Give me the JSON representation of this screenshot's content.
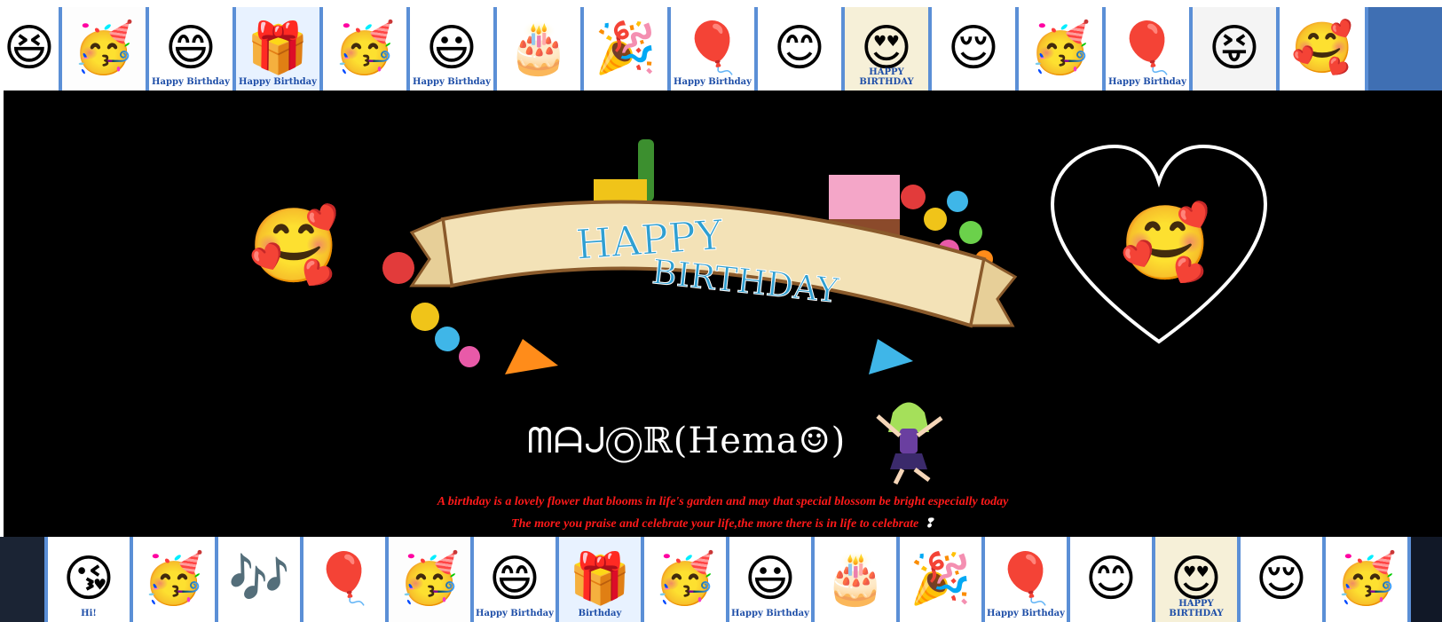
{
  "top_strip": {
    "tiles": [
      {
        "icon": "emoji-laugh-icon",
        "glyph": "😆",
        "bg": "#ffffff",
        "width": 70,
        "caption": ""
      },
      {
        "icon": "emoji-party-hat-icon",
        "glyph": "🥳",
        "bg": "#fdfdfd",
        "width": 98,
        "caption": ""
      },
      {
        "icon": "emoji-happy-birthday-icon",
        "glyph": "😄",
        "bg": "#ffffff",
        "width": 98,
        "caption": "Happy Birthday"
      },
      {
        "icon": "emoji-gift-icon",
        "glyph": "🎁",
        "bg": "#e8f2ff",
        "width": 98,
        "caption": "Happy Birthday"
      },
      {
        "icon": "emoji-blower-icon",
        "glyph": "🥳",
        "bg": "#ffffff",
        "width": 98,
        "caption": ""
      },
      {
        "icon": "emoji-thumbs-up-icon",
        "glyph": "😃",
        "bg": "#ffffff",
        "width": 98,
        "caption": "Happy Birthday"
      },
      {
        "icon": "emoji-cake-icon",
        "glyph": "🎂",
        "bg": "#ffffff",
        "width": 98,
        "caption": ""
      },
      {
        "icon": "emoji-confetti-icon",
        "glyph": "🎉",
        "bg": "#ffffff",
        "width": 98,
        "caption": ""
      },
      {
        "icon": "emoji-balloons-icon",
        "glyph": "🎈",
        "bg": "#ffffff",
        "width": 98,
        "caption": "Happy Birthday"
      },
      {
        "icon": "emoji-present-icon",
        "glyph": "😊",
        "bg": "#ffffff",
        "width": 98,
        "caption": ""
      },
      {
        "icon": "emoji-group-icon",
        "glyph": "😍",
        "bg": "#f6f0d8",
        "width": 98,
        "caption": "HAPPY BIRTHDAY"
      },
      {
        "icon": "emoji-spring-icon",
        "glyph": "😌",
        "bg": "#ffffff",
        "width": 98,
        "caption": ""
      },
      {
        "icon": "emoji-party-hat-big-icon",
        "glyph": "🥳",
        "bg": "#ffffff",
        "width": 98,
        "caption": ""
      },
      {
        "icon": "emoji-balloons-2-icon",
        "glyph": "🎈",
        "bg": "#ffffff",
        "width": 98,
        "caption": "Happy Birthday"
      },
      {
        "icon": "emoji-dance-icon",
        "glyph": "😝",
        "bg": "#f4f4f4",
        "width": 98,
        "caption": ""
      },
      {
        "icon": "emoji-love-cake-icon",
        "glyph": "🥰",
        "bg": "#ffffff",
        "width": 100,
        "caption": ""
      }
    ]
  },
  "banner": {
    "line1": "HAPPY",
    "line2": "BIRTHDAY"
  },
  "emoji_left": {
    "icon": "smiling-hearts-icon",
    "glyph": "🥰"
  },
  "emoji_heart": {
    "icon": "smiling-hearts-icon",
    "glyph": "🥰"
  },
  "name": "ᗰᗩᒍⓄℝ(Hema☺︎)",
  "quote_line1": "A birthday is a lovely flower that blooms in life's garden and may that special blossom be bright especially today",
  "quote_line2": "The more you praise and celebrate your life,the more there is in life to celebrate",
  "quote_line2_end": "❢",
  "bottom_strip": {
    "tiles": [
      {
        "icon": "dark-block-icon",
        "glyph": "",
        "bg": "#1b2434",
        "width": 54,
        "caption": ""
      },
      {
        "icon": "emoji-hi-icon",
        "glyph": "😘",
        "bg": "#ffffff",
        "width": 96,
        "caption": "Hi!"
      },
      {
        "icon": "emoji-party-hat-icon",
        "glyph": "🥳",
        "bg": "#ffffff",
        "width": 96,
        "caption": ""
      },
      {
        "icon": "emoji-music-icon",
        "glyph": "🎶",
        "bg": "#ffffff",
        "width": 96,
        "caption": ""
      },
      {
        "icon": "emoji-balloon-icon",
        "glyph": "🎈",
        "bg": "#ffffff",
        "width": 96,
        "caption": ""
      },
      {
        "icon": "emoji-party-cake-icon",
        "glyph": "🥳",
        "bg": "#fdfdfd",
        "width": 96,
        "caption": ""
      },
      {
        "icon": "emoji-happy-birthday-icon",
        "glyph": "😄",
        "bg": "#ffffff",
        "width": 96,
        "caption": "Happy Birthday"
      },
      {
        "icon": "emoji-gift-icon",
        "glyph": "🎁",
        "bg": "#e8f2ff",
        "width": 96,
        "caption": "Birthday"
      },
      {
        "icon": "emoji-blower-icon",
        "glyph": "🥳",
        "bg": "#ffffff",
        "width": 96,
        "caption": ""
      },
      {
        "icon": "emoji-thumbs-up-icon",
        "glyph": "😃",
        "bg": "#ffffff",
        "width": 96,
        "caption": "Happy Birthday"
      },
      {
        "icon": "emoji-cake-icon",
        "glyph": "🎂",
        "bg": "#ffffff",
        "width": 96,
        "caption": ""
      },
      {
        "icon": "emoji-confetti-icon",
        "glyph": "🎉",
        "bg": "#ffffff",
        "width": 96,
        "caption": ""
      },
      {
        "icon": "emoji-balloons-icon",
        "glyph": "🎈",
        "bg": "#ffffff",
        "width": 96,
        "caption": "Happy Birthday"
      },
      {
        "icon": "emoji-present-icon",
        "glyph": "😊",
        "bg": "#ffffff",
        "width": 96,
        "caption": ""
      },
      {
        "icon": "emoji-group-icon",
        "glyph": "😍",
        "bg": "#f6f0d8",
        "width": 96,
        "caption": "HAPPY BIRTHDAY"
      },
      {
        "icon": "emoji-spring-icon",
        "glyph": "😌",
        "bg": "#ffffff",
        "width": 96,
        "caption": ""
      },
      {
        "icon": "emoji-party-edge-icon",
        "glyph": "🥳",
        "bg": "#ffffff",
        "width": 96,
        "caption": ""
      }
    ]
  }
}
